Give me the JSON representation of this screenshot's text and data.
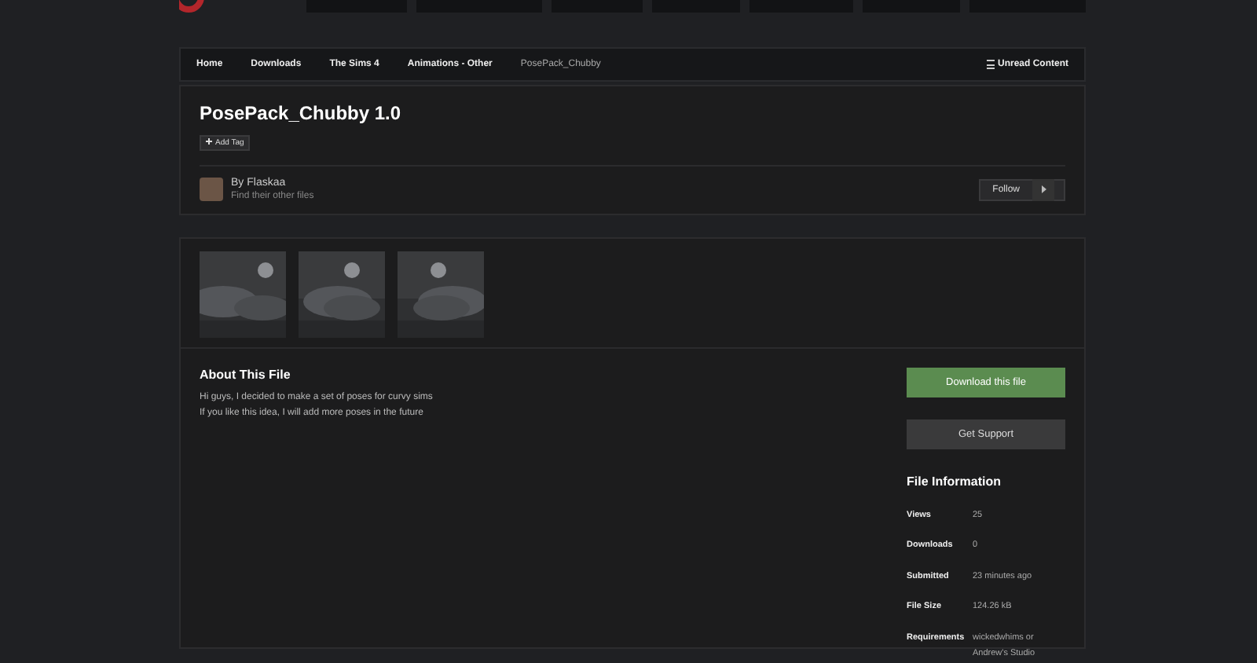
{
  "breadcrumbs": [
    {
      "label": "Home"
    },
    {
      "label": "Downloads"
    },
    {
      "label": "The Sims 4"
    },
    {
      "label": "Animations - Other"
    },
    {
      "label": "PosePack_Chubby"
    }
  ],
  "unread": "Unread Content",
  "file": {
    "title": "PosePack_Chubby 1.0",
    "add_tag": "Add Tag",
    "author": "By Flaskaa",
    "author_link": "Find their other files",
    "follow": "Follow"
  },
  "about": {
    "heading": "About This File",
    "lines": [
      "Hi guys, I decided to make a set of poses for curvy sims",
      "If you like this idea, I will add more poses in the future"
    ]
  },
  "actions": [
    {
      "label": "Download this file",
      "kind": "primary"
    },
    {
      "label": "Get Support",
      "kind": "secondary"
    }
  ],
  "file_info": {
    "heading": "File Information",
    "rows": [
      {
        "label": "Views",
        "value": "25"
      },
      {
        "label": "Downloads",
        "value": "0"
      },
      {
        "label": "Submitted",
        "value": "23 minutes ago"
      },
      {
        "label": "File Size",
        "value": "124.26 kB"
      },
      {
        "label": "Requirements",
        "value": "wickedwhims or Andrew's Studio"
      }
    ]
  }
}
